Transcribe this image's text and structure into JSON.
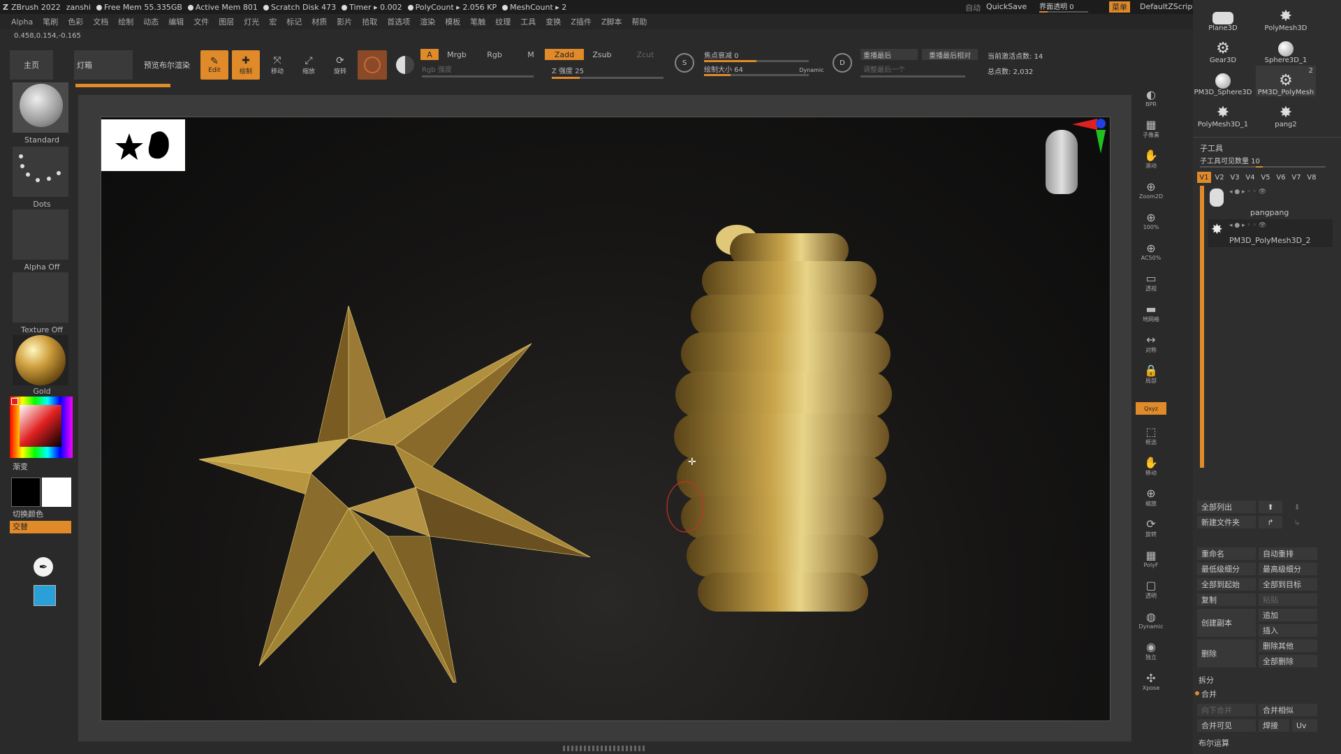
{
  "titlebar": {
    "app": "ZBrush 2022",
    "user": "zanshi",
    "free_mem": "Free Mem 55.335GB",
    "active_mem": "Active Mem 801",
    "scratch": "Scratch Disk 473",
    "timer": "Timer ▸ 0.002",
    "polycount": "PolyCount ▸ 2.056 KP",
    "meshcount": "MeshCount ▸ 2",
    "auto": "自动",
    "quicksave": "QuickSave",
    "transparency": "界面透明 0",
    "menu": "菜单",
    "script": "DefaultZScript",
    "accent": "#e08a2a"
  },
  "menubar": [
    "Alpha",
    "笔刷",
    "色彩",
    "文档",
    "绘制",
    "动态",
    "编辑",
    "文件",
    "图层",
    "灯光",
    "宏",
    "标记",
    "材质",
    "影片",
    "拾取",
    "首选项",
    "渲染",
    "模板",
    "笔触",
    "纹理",
    "工具",
    "变换",
    "Z插件",
    "Z脚本",
    "帮助"
  ],
  "coords": "0.458,0.154,-0.165",
  "toolbar": {
    "home": "主页",
    "lightbox": "灯箱",
    "bpr": "预览布尔渲染",
    "edit": "Edit",
    "draw": "绘制",
    "move": "移动",
    "scale": "缩放",
    "rotate": "旋转",
    "a": "A",
    "mrgb": "Mrgb",
    "rgb": "Rgb",
    "m": "M",
    "rgb_intensity": "Rgb 强度",
    "zadd": "Zadd",
    "zsub": "Zsub",
    "zcut": "Zcut",
    "z_intensity": "Z 强度 25",
    "focal_shift": "焦点衰减 0",
    "draw_size": "绘制大小 64",
    "dynamic": "Dynamic",
    "replay_last": "重播最后",
    "replay_last_rel": "重播最后相对",
    "adjust_last": "调整最后一个",
    "active_points": "当前激活点数: 14",
    "total_points": "总点数: 2,032",
    "z_intensity_level": 0.25,
    "draw_size_level": 0.25,
    "focal_level": 0.5
  },
  "leftpanel": {
    "brush": "Standard",
    "stroke": "Dots",
    "alpha": "Alpha Off",
    "texture": "Texture Off",
    "material": "Gold",
    "gradient": "渐变",
    "switch_color": "切换颜色",
    "alternate": "交替"
  },
  "rightstrip": [
    {
      "icon": "bpr-icon",
      "label": "BPR"
    },
    {
      "icon": "subpixel-icon",
      "label": "子像素"
    },
    {
      "icon": "scroll-icon",
      "label": "滚动"
    },
    {
      "icon": "zoom2d-icon",
      "label": "Zoom2D"
    },
    {
      "icon": "zoom100-icon",
      "label": "100%"
    },
    {
      "icon": "zoom50-icon",
      "label": "AC50%"
    },
    {
      "icon": "perspective-icon",
      "label": "透视"
    },
    {
      "icon": "floor-icon",
      "label": "地网格"
    },
    {
      "icon": "local-icon",
      "label": "对称"
    },
    {
      "icon": "lock-icon",
      "label": "局部"
    },
    {
      "icon": "xyz-icon",
      "label": "Qxyz"
    },
    {
      "icon": "frame-icon",
      "label": "框选"
    },
    {
      "icon": "move-icon",
      "label": "移动"
    },
    {
      "icon": "zoom-icon",
      "label": "缩放"
    },
    {
      "icon": "rotate-icon",
      "label": "旋转"
    },
    {
      "icon": "polyf-icon",
      "label": "PolyF"
    },
    {
      "icon": "transp-icon",
      "label": "透明"
    },
    {
      "icon": "ghost-icon",
      "label": "Dynamic"
    },
    {
      "icon": "solo-icon",
      "label": "独立"
    },
    {
      "icon": "xpose-icon",
      "label": "Xpose"
    }
  ],
  "rightpanel": {
    "thumbs": [
      "Plane3D",
      "PolyMesh3D",
      "Gear3D",
      "Sphere3D_1",
      "PM3D_Sphere3D",
      "PM3D_PolyMesh",
      "PolyMesh3D_1",
      "pang2"
    ],
    "thumb_badge": "2",
    "subtool_title": "子工具",
    "visible_count": "子工具可见数量 10",
    "vtabs": [
      "V1",
      "V2",
      "V3",
      "V4",
      "V5",
      "V6",
      "V7",
      "V8"
    ],
    "subtools": [
      "pangpang",
      "PM3D_PolyMesh3D_2"
    ],
    "list_all": "全部列出",
    "new_folder": "新建文件夹",
    "rename": "重命名",
    "auto_reorder": "自动重排",
    "lowest_sub": "最低级细分",
    "highest_sub": "最高级细分",
    "all_to_start": "全部到起始",
    "all_to_target": "全部到目标",
    "duplicate": "复制",
    "paste": "粘贴",
    "append": "追加",
    "create_copy": "创建副本",
    "insert": "插入",
    "delete": "删除",
    "delete_other": "删除其他",
    "delete_all": "全部删除",
    "split": "拆分",
    "merge": "合并",
    "merge_down": "向下合并",
    "merge_similar": "合并相似",
    "merge_visible": "合并可见",
    "weld": "焊接",
    "uv": "Uv",
    "boolean": "布尔运算"
  }
}
